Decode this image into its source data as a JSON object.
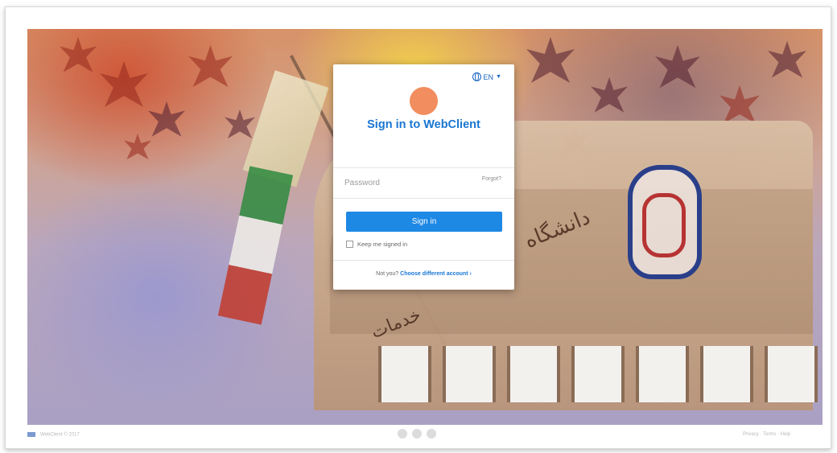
{
  "login": {
    "language": "EN",
    "title": "Sign in to WebClient",
    "password_placeholder": "Password",
    "forgot_label": "Forgot?",
    "sign_in_label": "Sign in",
    "keep_signed_in_label": "Keep me signed in",
    "not_you_text": "Not you?",
    "choose_account_label": "Choose different account",
    "choose_account_arrow": "›"
  },
  "status_bar": {
    "left_text": "WebClient © 2017",
    "right_text": "Privacy · Terms · Help"
  },
  "colors": {
    "accent": "#1e88e5",
    "title": "#1976d2",
    "avatar": "#f28d5f"
  }
}
